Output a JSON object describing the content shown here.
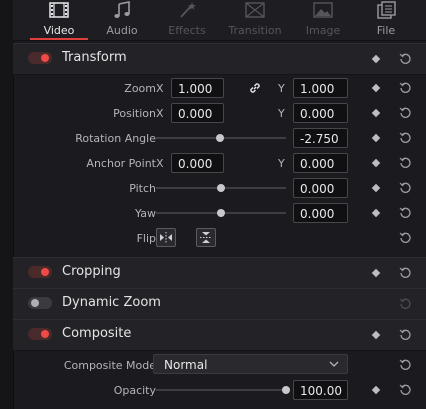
{
  "tabs": [
    {
      "label": "Video",
      "icon": "film-icon",
      "state": "active"
    },
    {
      "label": "Audio",
      "icon": "music-note-icon",
      "state": "normal"
    },
    {
      "label": "Effects",
      "icon": "magic-wand-icon",
      "state": "disabled"
    },
    {
      "label": "Transition",
      "icon": "transition-icon",
      "state": "disabled"
    },
    {
      "label": "Image",
      "icon": "image-icon",
      "state": "disabled"
    },
    {
      "label": "File",
      "icon": "file-icon",
      "state": "normal"
    }
  ],
  "transform": {
    "title": "Transform",
    "enabled": true,
    "zoom": {
      "label": "Zoom",
      "x_axis": "X",
      "y_axis": "Y",
      "x": "1.000",
      "y": "1.000"
    },
    "position": {
      "label": "Position",
      "x_axis": "X",
      "y_axis": "Y",
      "x": "0.000",
      "y": "0.000"
    },
    "rotation": {
      "label": "Rotation Angle",
      "value": "-2.750",
      "slider_fraction": 0.49
    },
    "anchor": {
      "label": "Anchor Point",
      "x_axis": "X",
      "y_axis": "Y",
      "x": "0.000",
      "y": "0.000"
    },
    "pitch": {
      "label": "Pitch",
      "value": "0.000",
      "slider_fraction": 0.5
    },
    "yaw": {
      "label": "Yaw",
      "value": "0.000",
      "slider_fraction": 0.5
    },
    "flip": {
      "label": "Flip"
    }
  },
  "cropping": {
    "title": "Cropping",
    "enabled": true
  },
  "dynamic_zoom": {
    "title": "Dynamic Zoom",
    "enabled": false
  },
  "composite": {
    "title": "Composite",
    "enabled": true,
    "mode": {
      "label": "Composite Mode",
      "value": "Normal"
    },
    "opacity": {
      "label": "Opacity",
      "value": "100.00",
      "slider_fraction": 1.0
    }
  },
  "colors": {
    "accent": "#e0403a",
    "background": "#1b1b1f",
    "section": "#232327"
  }
}
